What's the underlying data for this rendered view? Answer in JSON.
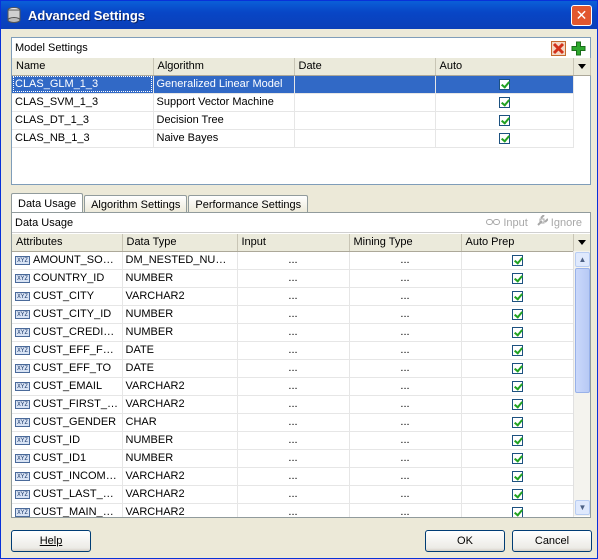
{
  "window": {
    "title": "Advanced Settings",
    "app_icon": "database-gear-icon"
  },
  "model_settings": {
    "label": "Model Settings",
    "columns": [
      "Name",
      "Algorithm",
      "Date",
      "Auto"
    ],
    "rows": [
      {
        "name": "CLAS_GLM_1_3",
        "algorithm": "Generalized Linear Model",
        "date": "",
        "auto": true,
        "selected": true
      },
      {
        "name": "CLAS_SVM_1_3",
        "algorithm": "Support Vector Machine",
        "date": "",
        "auto": true
      },
      {
        "name": "CLAS_DT_1_3",
        "algorithm": "Decision Tree",
        "date": "",
        "auto": true
      },
      {
        "name": "CLAS_NB_1_3",
        "algorithm": "Naive Bayes",
        "date": "",
        "auto": true
      }
    ]
  },
  "tabs": [
    "Data Usage",
    "Algorithm Settings",
    "Performance Settings"
  ],
  "data_usage": {
    "label": "Data Usage",
    "input_action": "Input",
    "ignore_action": "Ignore",
    "columns": [
      "Attributes",
      "Data Type",
      "Input",
      "Mining Type",
      "Auto Prep"
    ],
    "attr_icon_text": "XYZ",
    "rows": [
      {
        "attribute": "AMOUNT_SOLD_...",
        "type": "DM_NESTED_NUMERI...",
        "input": "...",
        "mining": "...",
        "auto": true
      },
      {
        "attribute": "COUNTRY_ID",
        "type": "NUMBER",
        "input": "...",
        "mining": "...",
        "auto": true
      },
      {
        "attribute": "CUST_CITY",
        "type": "VARCHAR2",
        "input": "...",
        "mining": "...",
        "auto": true
      },
      {
        "attribute": "CUST_CITY_ID",
        "type": "NUMBER",
        "input": "...",
        "mining": "...",
        "auto": true
      },
      {
        "attribute": "CUST_CREDIT_LI...",
        "type": "NUMBER",
        "input": "...",
        "mining": "...",
        "auto": true
      },
      {
        "attribute": "CUST_EFF_FROM",
        "type": "DATE",
        "input": "...",
        "mining": "...",
        "auto": true
      },
      {
        "attribute": "CUST_EFF_TO",
        "type": "DATE",
        "input": "...",
        "mining": "...",
        "auto": true
      },
      {
        "attribute": "CUST_EMAIL",
        "type": "VARCHAR2",
        "input": "...",
        "mining": "...",
        "auto": true
      },
      {
        "attribute": "CUST_FIRST_NAME",
        "type": "VARCHAR2",
        "input": "...",
        "mining": "...",
        "auto": true
      },
      {
        "attribute": "CUST_GENDER",
        "type": "CHAR",
        "input": "...",
        "mining": "...",
        "auto": true
      },
      {
        "attribute": "CUST_ID",
        "type": "NUMBER",
        "input": "...",
        "mining": "...",
        "auto": true
      },
      {
        "attribute": "CUST_ID1",
        "type": "NUMBER",
        "input": "...",
        "mining": "...",
        "auto": true
      },
      {
        "attribute": "CUST_INCOME_L...",
        "type": "VARCHAR2",
        "input": "...",
        "mining": "...",
        "auto": true
      },
      {
        "attribute": "CUST_LAST_NAME",
        "type": "VARCHAR2",
        "input": "...",
        "mining": "...",
        "auto": true
      },
      {
        "attribute": "CUST_MAIN_PH...",
        "type": "VARCHAR2",
        "input": "...",
        "mining": "...",
        "auto": true
      }
    ]
  },
  "buttons": {
    "help": "Help",
    "ok": "OK",
    "cancel": "Cancel"
  }
}
